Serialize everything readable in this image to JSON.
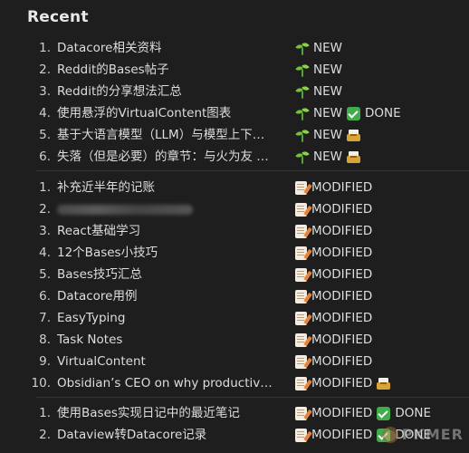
{
  "heading": "Recent",
  "group1": [
    {
      "num": "1.",
      "title": "Datacore相关资料",
      "status": [
        {
          "icon": "seedling-icon",
          "label": "NEW"
        }
      ]
    },
    {
      "num": "2.",
      "title": "Reddit的Bases帖子",
      "status": [
        {
          "icon": "seedling-icon",
          "label": "NEW"
        }
      ]
    },
    {
      "num": "3.",
      "title": "Reddit的分享想法汇总",
      "status": [
        {
          "icon": "seedling-icon",
          "label": "NEW"
        }
      ]
    },
    {
      "num": "4.",
      "title": "使用悬浮的VirtualContent图表",
      "status": [
        {
          "icon": "seedling-icon",
          "label": "NEW"
        },
        {
          "icon": "check-icon",
          "label": "DONE"
        }
      ]
    },
    {
      "num": "5.",
      "title": "基于大语言模型（LLM）与模型上下…",
      "status": [
        {
          "icon": "seedling-icon",
          "label": "NEW"
        },
        {
          "icon": "inbox-tray-icon",
          "label": ""
        }
      ]
    },
    {
      "num": "6.",
      "title": "失落（但是必要）的章节：与火为友 …",
      "status": [
        {
          "icon": "seedling-icon",
          "label": "NEW"
        },
        {
          "icon": "inbox-tray-icon",
          "label": ""
        }
      ]
    }
  ],
  "group2": [
    {
      "num": "1.",
      "title": "补充近半年的记账",
      "status": [
        {
          "icon": "memo-icon",
          "label": "MODIFIED"
        }
      ]
    },
    {
      "num": "2.",
      "title": "",
      "blurred": true,
      "status": [
        {
          "icon": "memo-icon",
          "label": "MODIFIED"
        }
      ]
    },
    {
      "num": "3.",
      "title": "React基础学习",
      "status": [
        {
          "icon": "memo-icon",
          "label": "MODIFIED"
        }
      ]
    },
    {
      "num": "4.",
      "title": "12个Bases小技巧",
      "status": [
        {
          "icon": "memo-icon",
          "label": "MODIFIED"
        }
      ]
    },
    {
      "num": "5.",
      "title": "Bases技巧汇总",
      "status": [
        {
          "icon": "memo-icon",
          "label": "MODIFIED"
        }
      ]
    },
    {
      "num": "6.",
      "title": "Datacore用例",
      "status": [
        {
          "icon": "memo-icon",
          "label": "MODIFIED"
        }
      ]
    },
    {
      "num": "7.",
      "title": "EasyTyping",
      "status": [
        {
          "icon": "memo-icon",
          "label": "MODIFIED"
        }
      ]
    },
    {
      "num": "8.",
      "title": "Task Notes",
      "status": [
        {
          "icon": "memo-icon",
          "label": "MODIFIED"
        }
      ]
    },
    {
      "num": "9.",
      "title": "VirtualContent",
      "status": [
        {
          "icon": "memo-icon",
          "label": "MODIFIED"
        }
      ]
    },
    {
      "num": "10.",
      "title": "Obsidian’s CEO on why productivit…",
      "status": [
        {
          "icon": "memo-icon",
          "label": "MODIFIED"
        },
        {
          "icon": "inbox-tray-icon",
          "label": ""
        }
      ]
    }
  ],
  "group3": [
    {
      "num": "1.",
      "title": "使用Bases实现日记中的最近笔记",
      "status": [
        {
          "icon": "memo-icon",
          "label": "MODIFIED"
        },
        {
          "icon": "check-icon",
          "label": "DONE"
        }
      ]
    },
    {
      "num": "2.",
      "title": "Dataview转Datacore记录",
      "status": [
        {
          "icon": "memo-icon",
          "label": "MODIFIED"
        },
        {
          "icon": "check-icon",
          "label": "DONE"
        }
      ]
    }
  ],
  "watermark": "PKMER"
}
